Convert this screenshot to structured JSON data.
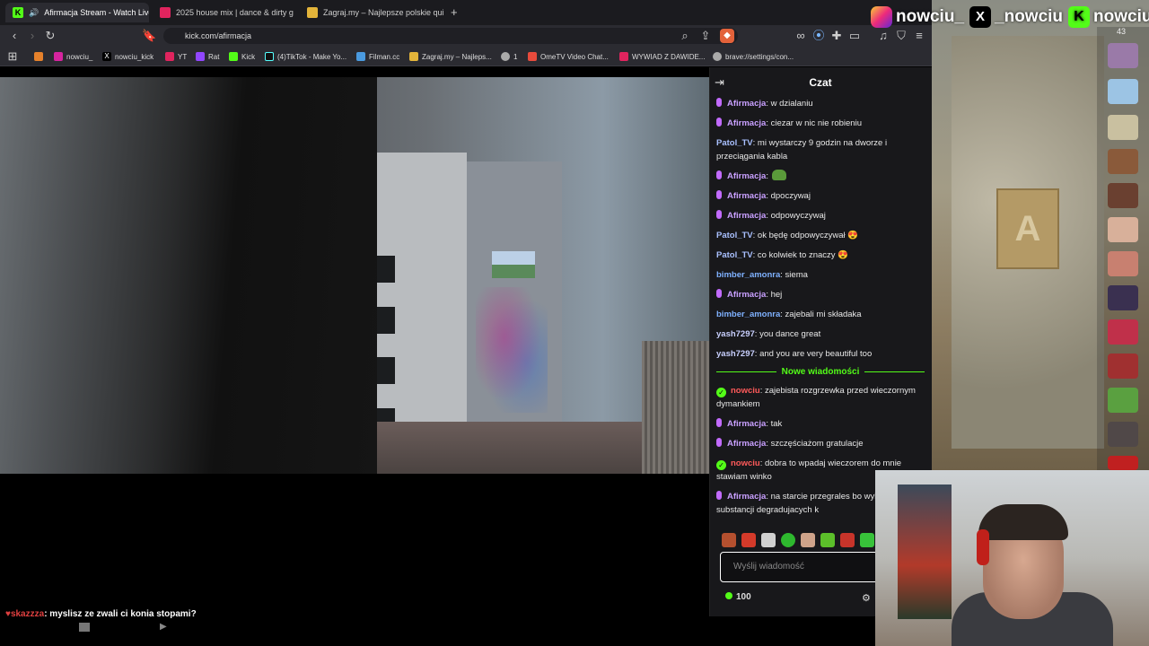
{
  "browser": {
    "tabs": [
      {
        "title": "Afirmacja Stream - Watch Live",
        "active": true,
        "icon": "kick-icon"
      },
      {
        "title": "2025 house mix | dance & dirty g",
        "active": false,
        "icon": "youtube-icon"
      },
      {
        "title": "Zagraj.my – Najlepsze polskie quizy o",
        "active": false,
        "icon": "crown-icon"
      }
    ],
    "new_tab": "+",
    "url": "kick.com/afirmacja",
    "bookmarks": [
      "nowciu_",
      "nowciu_kick",
      "YT",
      "Rat",
      "Kick",
      "(4)TikTok - Make Yo...",
      "Filman.cc",
      "Zagraj.my – Najleps...",
      "1",
      "OmeTV Video Chat...",
      "WYWIAD Z DAWIDE...",
      "brave://settings/con..."
    ]
  },
  "video": {
    "overlay_chat_user": "skazzza",
    "overlay_chat_text": ": myslisz ze zwali ci konia stopami?"
  },
  "chat": {
    "title": "Czat",
    "messages_before": [
      {
        "user": "Afirmacja",
        "text": ": w dzialaniu",
        "badge": "mic"
      },
      {
        "user": "Afirmacja",
        "text": ": ciezar w nic nie robieniu",
        "badge": "mic"
      },
      {
        "user": "Patol_TV",
        "text": ": mi wystarczy 9 godzin na dworze i przeciągania kabla",
        "badge": ""
      },
      {
        "user": "Afirmacja",
        "text": ":",
        "badge": "mic",
        "emote": true
      },
      {
        "user": "Afirmacja",
        "text": ": dpoczywaj",
        "badge": "mic"
      },
      {
        "user": "Afirmacja",
        "text": ": odpowyczywaj",
        "badge": "mic"
      },
      {
        "user": "Patol_TV",
        "text": ": ok będę odpowyczywał 😍",
        "badge": ""
      },
      {
        "user": "Patol_TV",
        "text": ": co kolwiek to znaczy 😍",
        "badge": ""
      },
      {
        "user": "bimber_amonra",
        "text": ": siema",
        "badge": ""
      },
      {
        "user": "Afirmacja",
        "text": ": hej",
        "badge": "mic"
      },
      {
        "user": "bimber_amonra",
        "text": ": zajebali mi składaka",
        "badge": ""
      },
      {
        "user": "yash7297",
        "text": ": you dance great",
        "badge": ""
      },
      {
        "user": "yash7297",
        "text": ": and you are very beautiful too",
        "badge": ""
      }
    ],
    "new_messages_label": "Nowe wiadomości",
    "messages_after": [
      {
        "user": "nowciu",
        "text": ": zajebista rozgrzewka przed wieczornym dymankiem",
        "badge": "check"
      },
      {
        "user": "Afirmacja",
        "text": ": tak",
        "badge": "mic"
      },
      {
        "user": "Afirmacja",
        "text": ": szczęściażom gratulacje",
        "badge": "mic"
      },
      {
        "user": "nowciu",
        "text": ": dobra to wpadaj wieczorem do mnie stawiam winko",
        "badge": "check"
      },
      {
        "user": "Afirmacja",
        "text": ": na starcie przegrales bo wybieram substancji degradujacych k",
        "badge": "mic"
      }
    ],
    "input_placeholder": "Wyślij wiadomość",
    "points": "100"
  },
  "overlay": {
    "viewer_count": "43",
    "socials": [
      "nowciu_",
      "_nowciu",
      "nowciu"
    ]
  },
  "colors": {
    "kick_green": "#53fc18",
    "chat_bg": "#18181b",
    "afirmacja_name": "#c9a0ff",
    "nowciu_name": "#ff5a5a"
  }
}
